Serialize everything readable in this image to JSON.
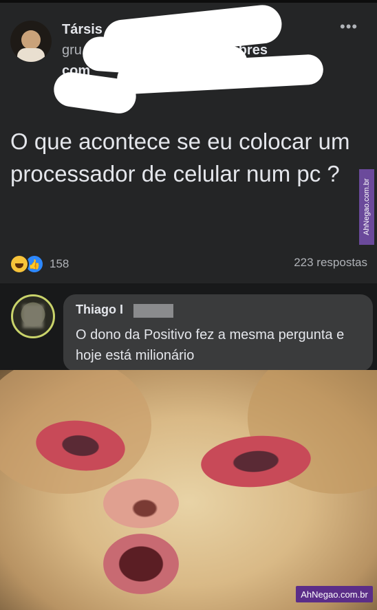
{
  "post": {
    "author": "Társis",
    "group_partial": "gru",
    "group_tail": "as pobres",
    "group_line2": "com",
    "more_icon": "more-horizontal-icon",
    "text": "O que acontece se eu colocar um processador de celular num pc ?",
    "reaction_count": "158",
    "replies": "223 respostas"
  },
  "comment": {
    "author": "Thiago I",
    "text": "O dono da Positivo fez a mesma pergunta e hoje está milionário"
  },
  "watermarks": {
    "vertical": "AhNegao.com.br",
    "corner": "AhNegao.com.br"
  },
  "colors": {
    "post_bg": "#242526",
    "bubble_bg": "#3a3b3c",
    "like_blue": "#2d88ff",
    "watermark_purple": "#5b2d88"
  }
}
